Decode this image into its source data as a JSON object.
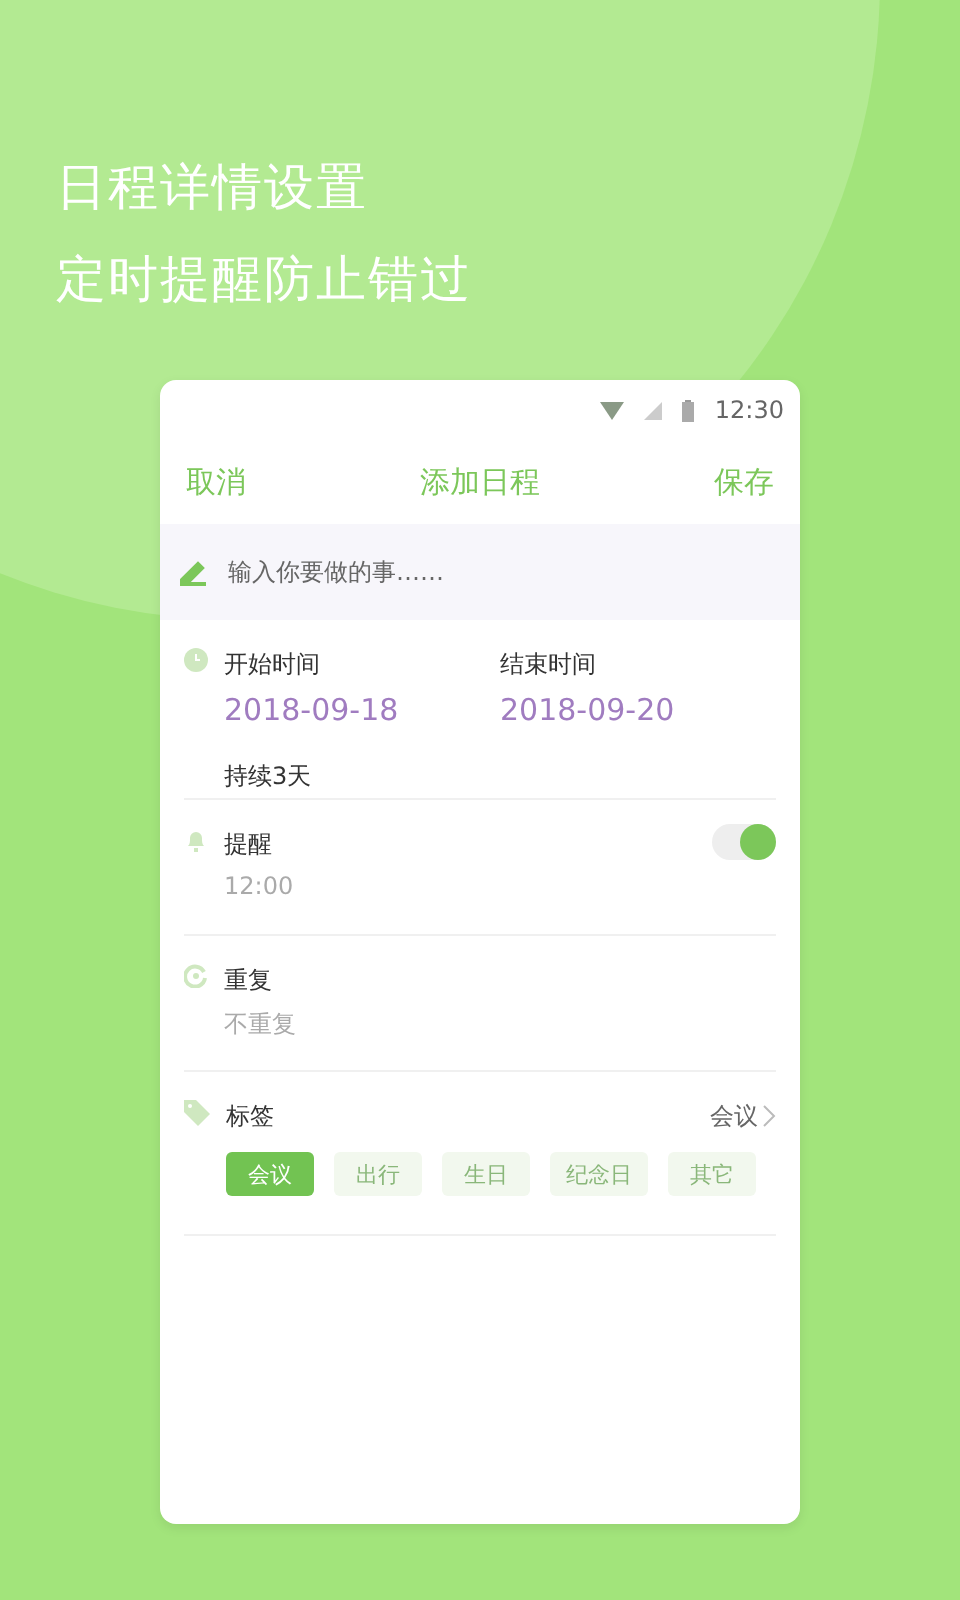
{
  "headline": [
    "日程详情设置",
    "定时提醒防止错过"
  ],
  "status_bar": {
    "time": "12:30"
  },
  "header": {
    "cancel": "取消",
    "title": "添加日程",
    "save": "保存"
  },
  "task_field": {
    "placeholder": "输入你要做的事……"
  },
  "time": {
    "start_label": "开始时间",
    "start_value": "2018-09-18",
    "end_label": "结束时间",
    "end_value": "2018-09-20",
    "duration": "持续3天"
  },
  "reminder": {
    "label": "提醒",
    "value": "12:00",
    "on": true
  },
  "repeat": {
    "label": "重复",
    "value": "不重复"
  },
  "tags": {
    "label": "标签",
    "current": "会议",
    "items": [
      {
        "label": "会议",
        "selected": true
      },
      {
        "label": "出行",
        "selected": false
      },
      {
        "label": "生日",
        "selected": false
      },
      {
        "label": "纪念日",
        "selected": false
      },
      {
        "label": "其它",
        "selected": false
      }
    ]
  }
}
